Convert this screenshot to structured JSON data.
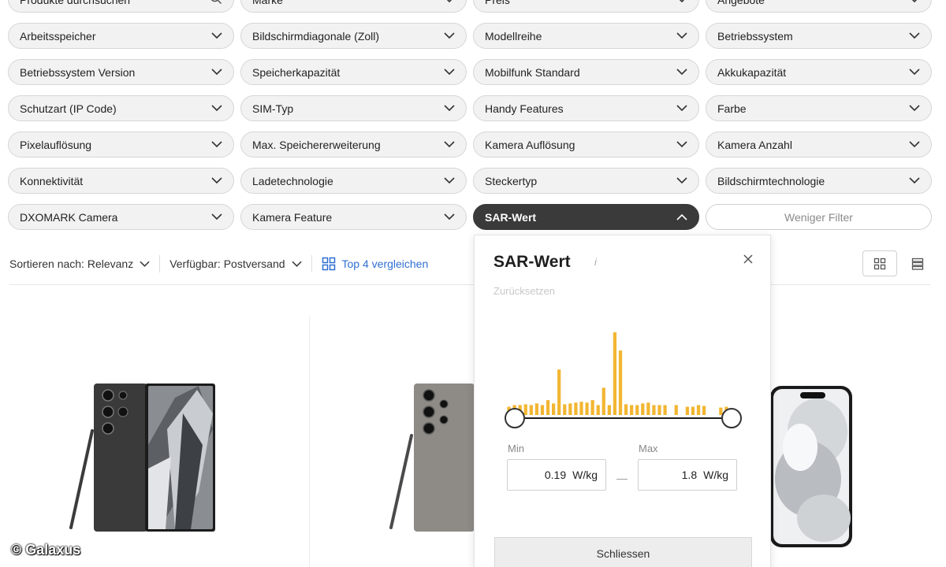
{
  "filters": [
    {
      "label": "Produkte durchsuchen",
      "icon": "search-icon"
    },
    {
      "label": "Marke"
    },
    {
      "label": "Preis"
    },
    {
      "label": "Angebote"
    },
    {
      "label": "Arbeitsspeicher"
    },
    {
      "label": "Bildschirmdiagonale (Zoll)"
    },
    {
      "label": "Modellreihe"
    },
    {
      "label": "Betriebssystem"
    },
    {
      "label": "Betriebssystem Version"
    },
    {
      "label": "Speicherkapazität"
    },
    {
      "label": "Mobilfunk Standard"
    },
    {
      "label": "Akkukapazität"
    },
    {
      "label": "Schutzart (IP Code)"
    },
    {
      "label": "SIM-Typ"
    },
    {
      "label": "Handy Features"
    },
    {
      "label": "Farbe"
    },
    {
      "label": "Pixelauflösung"
    },
    {
      "label": "Max. Speichererweiterung"
    },
    {
      "label": "Kamera Auflösung"
    },
    {
      "label": "Kamera Anzahl"
    },
    {
      "label": "Konnektivität"
    },
    {
      "label": "Ladetechnologie"
    },
    {
      "label": "Steckertyp"
    },
    {
      "label": "Bildschirmtechnologie"
    },
    {
      "label": "DXOMARK Camera"
    },
    {
      "label": "Kamera Feature"
    },
    {
      "label": "SAR-Wert",
      "active": true
    },
    {
      "label": "Weniger Filter",
      "outline": true
    }
  ],
  "sortbar": {
    "sort": "Sortieren nach: Relevanz",
    "availability": "Verfügbar: Postversand",
    "compare": "Top 4 vergleichen"
  },
  "popup": {
    "title": "SAR-Wert",
    "info": "i",
    "reset": "Zurücksetzen",
    "min_label": "Min",
    "max_label": "Max",
    "min_value": "0.19",
    "max_value": "1.8",
    "unit": "W/kg",
    "dash": "—",
    "close_button": "Schliessen",
    "histogram": [
      0.1,
      0.12,
      0.12,
      0.13,
      0.12,
      0.14,
      0.12,
      0.18,
      0.14,
      0.55,
      0.13,
      0.14,
      0.15,
      0.16,
      0.15,
      0.18,
      0.12,
      0.33,
      0.12,
      1.0,
      0.78,
      0.13,
      0.12,
      0.12,
      0.14,
      0.15,
      0.12,
      0.12,
      0.12,
      0,
      0.12,
      0,
      0.1,
      0.1,
      0.12,
      0.11,
      0,
      0,
      0.09,
      0.1,
      0.08
    ],
    "accent_color": "#f2b632"
  },
  "watermark": "© Galaxus"
}
